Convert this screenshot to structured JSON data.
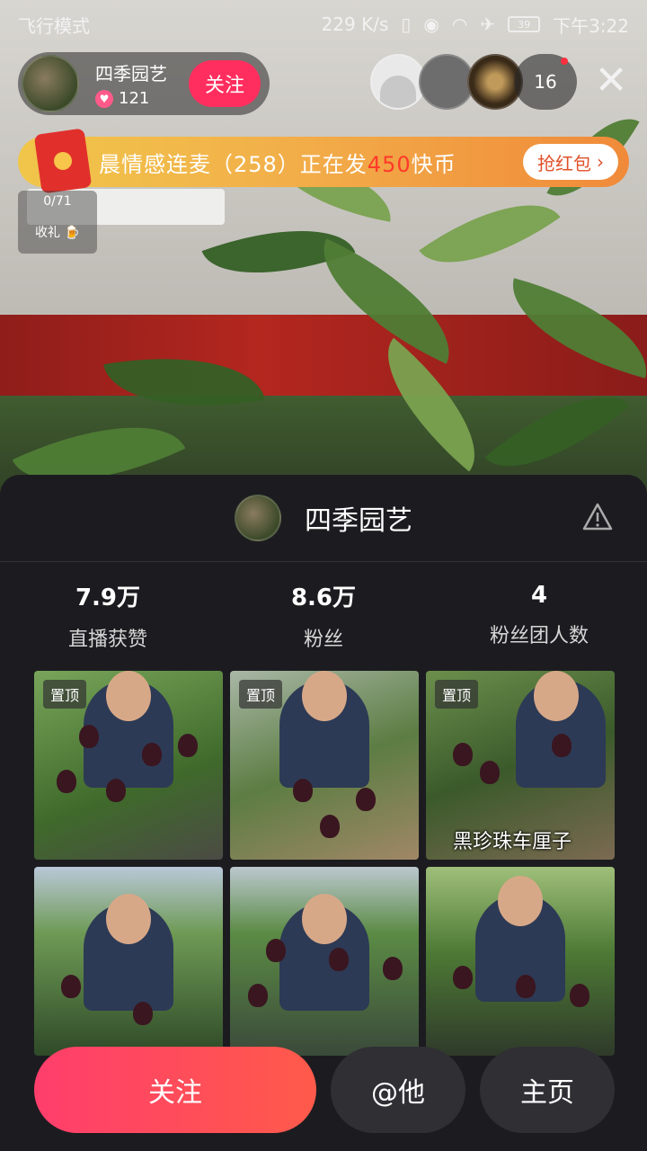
{
  "status_bar": {
    "left_text": "飞行模式",
    "net_speed": "229 K/s",
    "battery": "39",
    "time": "下午3:22"
  },
  "host": {
    "name": "四季园艺",
    "likes": "121",
    "follow_label": "关注"
  },
  "viewers": {
    "count": "16"
  },
  "promo": {
    "text_prefix": "晨情感连麦（258）正在发",
    "amount": "450",
    "text_suffix": "快币",
    "button_label": "抢红包"
  },
  "gifts": {
    "progress": "0/71",
    "label": "收礼"
  },
  "profile": {
    "name": "四季园艺",
    "stats": [
      {
        "value": "7.9万",
        "label": "直播获赞"
      },
      {
        "value": "8.6万",
        "label": "粉丝"
      },
      {
        "value": "4",
        "label": "粉丝团人数"
      }
    ],
    "videos": [
      {
        "pinned": "置顶",
        "caption": ""
      },
      {
        "pinned": "置顶",
        "caption": ""
      },
      {
        "pinned": "置顶",
        "caption": "黑珍珠车厘子"
      },
      {
        "pinned": "",
        "caption": ""
      },
      {
        "pinned": "",
        "caption": ""
      },
      {
        "pinned": "",
        "caption": ""
      }
    ],
    "actions": {
      "follow": "关注",
      "mention": "@他",
      "homepage": "主页"
    }
  },
  "icons": {
    "close": "close-icon",
    "warning": "warning-icon",
    "heart": "heart-icon",
    "red_packet": "red-packet-icon"
  },
  "colors": {
    "accent": "#ff3e6c",
    "sheet_bg": "#1c1c20",
    "promo_orange": "#f2b14a"
  }
}
